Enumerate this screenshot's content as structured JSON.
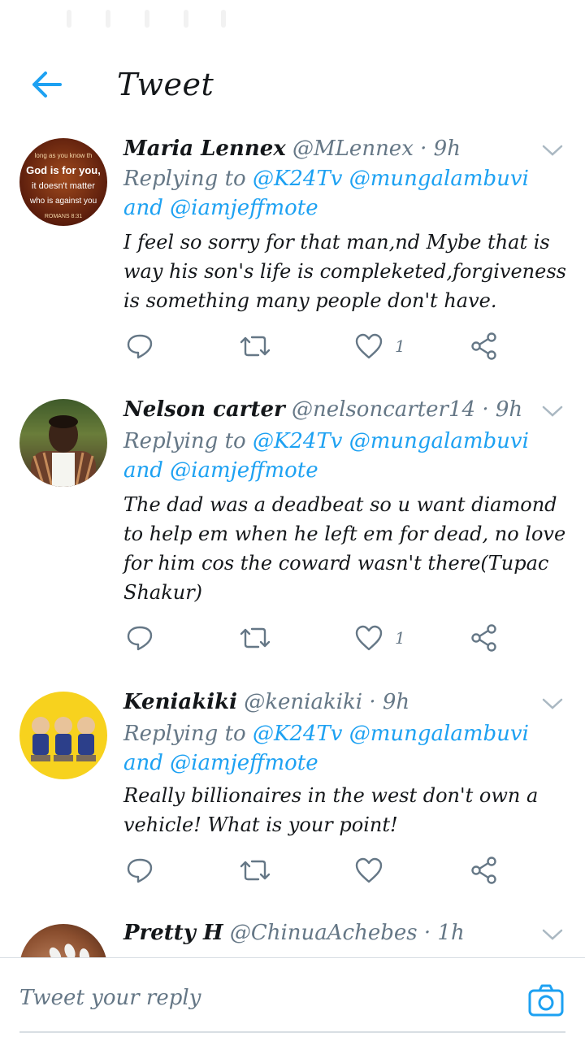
{
  "header": {
    "title": "Tweet"
  },
  "tweets": [
    {
      "name": "Maria Lennex",
      "handle": "@MLennex",
      "time": "· 9h",
      "replying_prefix": "Replying to",
      "mention1": "@K24Tv",
      "mention2": "@mungalambuvi",
      "and": "and",
      "mention3": "@iamjeffmote",
      "text": "I feel so sorry for that man,nd Mybe that is way his son's life is compleketed,forgiveness is something many people don't have.",
      "likes": "1",
      "avatar_text": [
        "long as you know th",
        "God is for you,",
        "it doesn't matter",
        "who is against you",
        "ROMANS 8:31"
      ]
    },
    {
      "name": "Nelson carter",
      "handle": "@nelsoncarter14",
      "time": "· 9h",
      "replying_prefix": "Replying to",
      "mention1": "@K24Tv",
      "mention2": "@mungalambuvi",
      "and": "and",
      "mention3": "@iamjeffmote",
      "text": "The dad was a deadbeat so u want diamond to help em when he left em for dead, no love for him cos the coward wasn't there(Tupac Shakur)",
      "likes": "1"
    },
    {
      "name": "Keniakiki",
      "handle": "@keniakiki",
      "time": "· 9h",
      "replying_prefix": "Replying to",
      "mention1": "@K24Tv",
      "mention2": "@mungalambuvi",
      "and": "and",
      "mention3": "@iamjeffmote",
      "text": "Really billionaires in the west don't own a vehicle! What is your point!",
      "likes": ""
    },
    {
      "name": "Pretty H",
      "handle": "@ChinuaAchebes",
      "time": "· 1h"
    }
  ],
  "composer": {
    "placeholder": "Tweet your reply"
  },
  "colors": {
    "accent": "#1da1f2",
    "secondary_text": "#657786",
    "divider": "#e1e8ed"
  },
  "icons": [
    "back-arrow-icon",
    "chevron-down-icon",
    "reply-icon",
    "retweet-icon",
    "like-icon",
    "share-icon",
    "camera-icon"
  ]
}
